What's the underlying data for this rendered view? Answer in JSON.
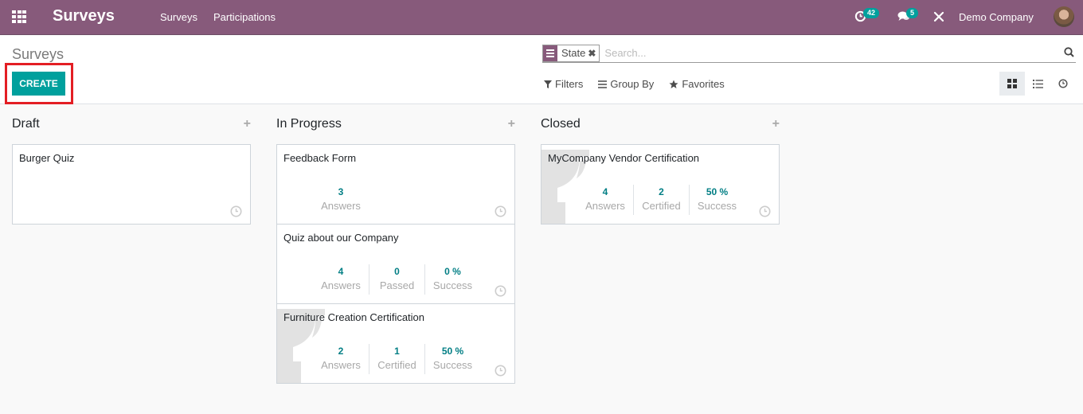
{
  "navbar": {
    "app_title": "Surveys",
    "menu": [
      "Surveys",
      "Participations"
    ],
    "activity_count": "42",
    "message_count": "5",
    "company": "Demo Company",
    "brand_color": "#875a7b",
    "accent_color": "#00a09d"
  },
  "control_panel": {
    "breadcrumb": "Surveys",
    "create_label": "CREATE",
    "search": {
      "facet_label": "State",
      "placeholder": "Search..."
    },
    "filters_label": "Filters",
    "group_by_label": "Group By",
    "favorites_label": "Favorites",
    "views": [
      "kanban",
      "list",
      "activity"
    ],
    "active_view": "kanban"
  },
  "kanban": {
    "columns": [
      {
        "title": "Draft",
        "cards": [
          {
            "title": "Burger Quiz",
            "certification": false,
            "stats": []
          }
        ]
      },
      {
        "title": "In Progress",
        "cards": [
          {
            "title": "Feedback Form",
            "certification": false,
            "stats": [
              {
                "value": "3",
                "label": "Answers"
              }
            ]
          },
          {
            "title": "Quiz about our Company",
            "certification": false,
            "stats": [
              {
                "value": "4",
                "label": "Answers"
              },
              {
                "value": "0",
                "label": "Passed"
              },
              {
                "value": "0 %",
                "label": "Success"
              }
            ]
          },
          {
            "title": "Furniture Creation Certification",
            "certification": true,
            "stats": [
              {
                "value": "2",
                "label": "Answers"
              },
              {
                "value": "1",
                "label": "Certified"
              },
              {
                "value": "50 %",
                "label": "Success"
              }
            ]
          }
        ]
      },
      {
        "title": "Closed",
        "cards": [
          {
            "title": "MyCompany Vendor Certification",
            "certification": true,
            "stats": [
              {
                "value": "4",
                "label": "Answers"
              },
              {
                "value": "2",
                "label": "Certified"
              },
              {
                "value": "50 %",
                "label": "Success"
              }
            ]
          }
        ]
      }
    ]
  }
}
